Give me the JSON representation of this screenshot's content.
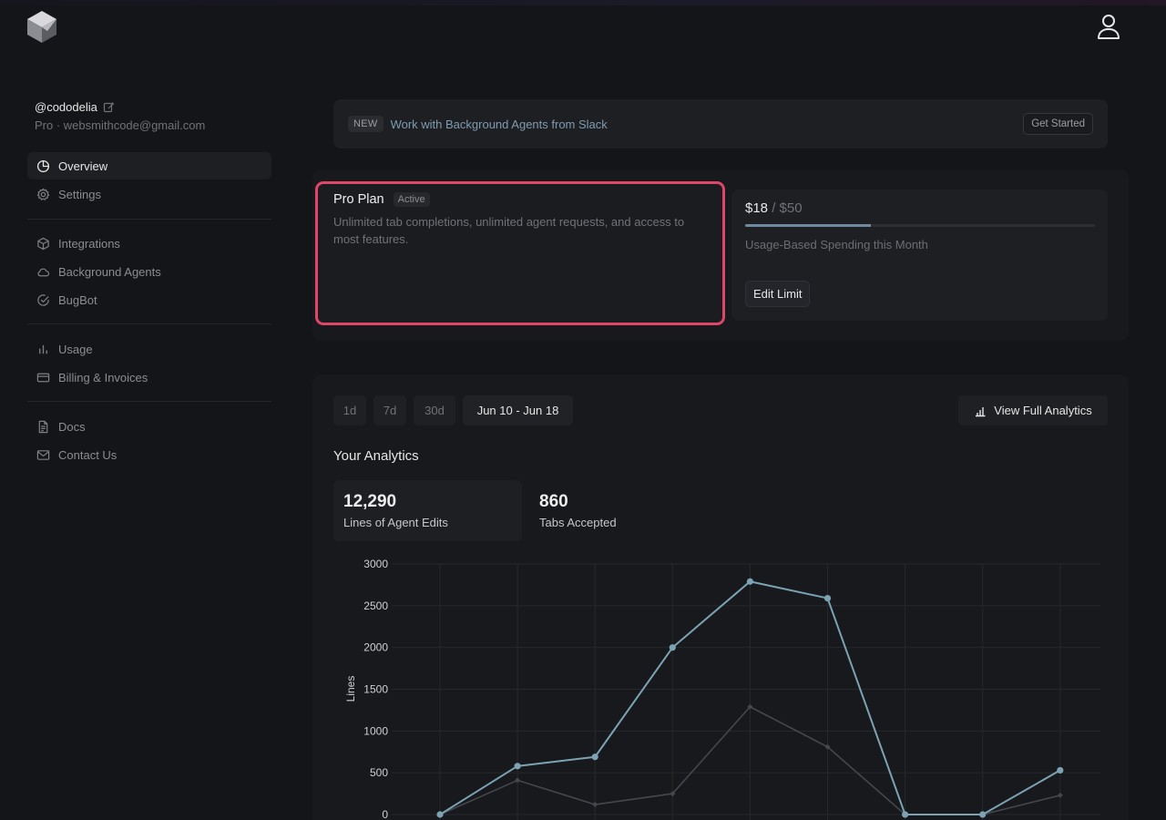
{
  "profile": {
    "username": "@cododelia",
    "subtitle": "Pro · websmithcode@gmail.com"
  },
  "sidebar": {
    "groups": [
      [
        {
          "label": "Overview",
          "icon": "pie-chart-icon",
          "active": true
        },
        {
          "label": "Settings",
          "icon": "gear-icon"
        }
      ],
      [
        {
          "label": "Integrations",
          "icon": "cube-icon"
        },
        {
          "label": "Background Agents",
          "icon": "cloud-icon"
        },
        {
          "label": "BugBot",
          "icon": "check-circle-icon"
        }
      ],
      [
        {
          "label": "Usage",
          "icon": "bar-chart-icon"
        },
        {
          "label": "Billing & Invoices",
          "icon": "credit-card-icon"
        }
      ],
      [
        {
          "label": "Docs",
          "icon": "document-icon"
        },
        {
          "label": "Contact Us",
          "icon": "mail-icon"
        }
      ]
    ]
  },
  "banner": {
    "badge": "NEW",
    "text": "Work with Background Agents from Slack",
    "button": "Get Started"
  },
  "plan": {
    "name": "Pro Plan",
    "status": "Active",
    "description": "Unlimited tab completions, unlimited agent requests, and access to most features."
  },
  "usage": {
    "amount": "$18",
    "limit": " / $50",
    "progress_fraction": 0.36,
    "caption": "Usage-Based Spending this Month",
    "edit_button": "Edit Limit"
  },
  "analytics": {
    "ranges": [
      "1d",
      "7d",
      "30d",
      "Jun 10 - Jun 18"
    ],
    "selected_range": "Jun 10 - Jun 18",
    "view_full": "View Full Analytics",
    "title": "Your Analytics",
    "stats": [
      {
        "value": "12,290",
        "label": "Lines of Agent Edits",
        "active": true
      },
      {
        "value": "860",
        "label": "Tabs Accepted"
      }
    ]
  },
  "colors": {
    "accent_highlight": "#e0456a",
    "series_primary": "#7ba3b3",
    "series_secondary": "#44474d",
    "background": "#141518"
  },
  "chart_data": {
    "type": "line",
    "ylabel": "Lines",
    "ylim": [
      0,
      3000
    ],
    "yticks": [
      0,
      500,
      1000,
      1500,
      2000,
      2500,
      3000
    ],
    "x": [
      0,
      1,
      2,
      3,
      4,
      5,
      6,
      7,
      8
    ],
    "series": [
      {
        "values": [
          0,
          580,
          690,
          2000,
          2790,
          2590,
          0,
          0,
          530
        ]
      },
      {
        "values": [
          0,
          410,
          120,
          250,
          1290,
          810,
          0,
          0,
          230
        ]
      }
    ],
    "grid": true
  }
}
